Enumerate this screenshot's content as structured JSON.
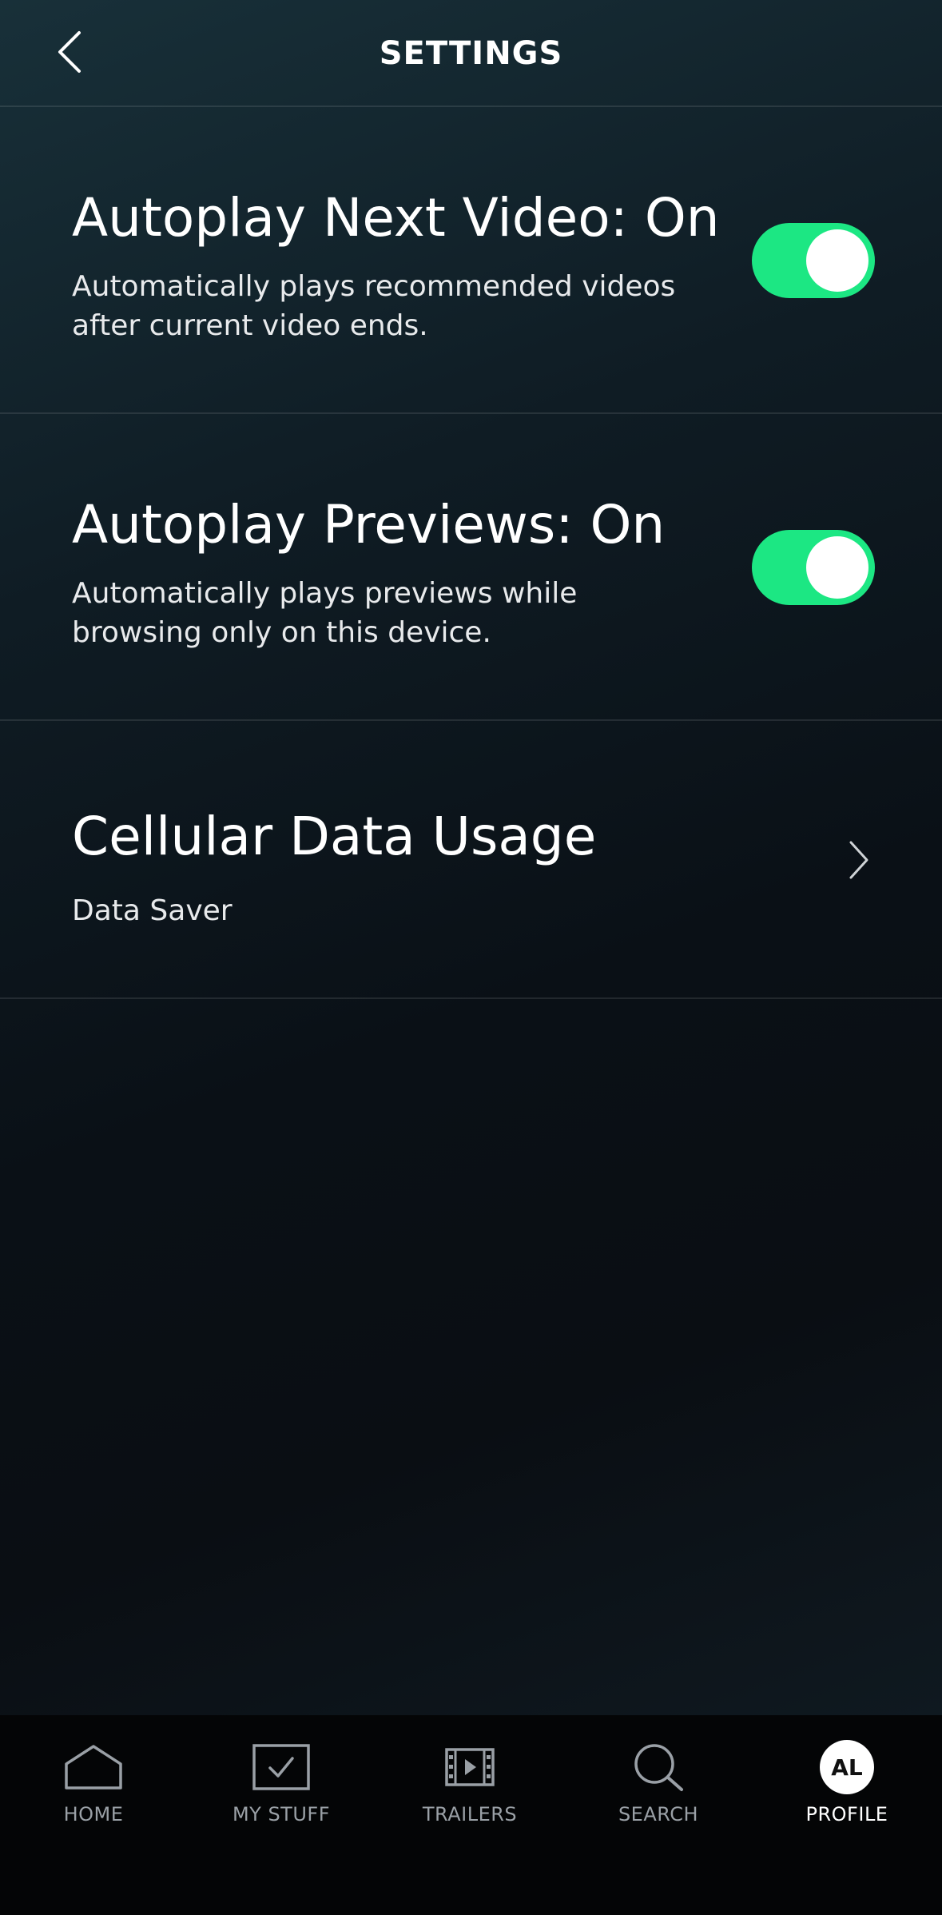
{
  "header": {
    "title": "SETTINGS",
    "back_icon": "chevron-left-icon"
  },
  "settings": [
    {
      "title": "Autoplay Next Video: On",
      "description": "Automatically plays recommended videos after current video ends.",
      "control": "toggle",
      "enabled": true
    },
    {
      "title": "Autoplay Previews: On",
      "description": "Automatically plays previews while browsing only on this device.",
      "control": "toggle",
      "enabled": true
    },
    {
      "title": "Cellular Data Usage",
      "description": "Data Saver",
      "control": "chevron",
      "icon": "chevron-right-icon"
    }
  ],
  "tabbar": {
    "tabs": [
      {
        "label": "HOME",
        "icon": "home-icon"
      },
      {
        "label": "MY STUFF",
        "icon": "checkbox-icon"
      },
      {
        "label": "TRAILERS",
        "icon": "film-icon"
      },
      {
        "label": "SEARCH",
        "icon": "search-icon"
      },
      {
        "label": "PROFILE",
        "icon": "avatar",
        "initials": "AL",
        "active": true
      }
    ]
  },
  "colors": {
    "accent": "#1ce783",
    "background_top": "#183039",
    "background_bottom": "#0a0e13",
    "tabbar": "#040506",
    "inactive_label": "#9aa0a6"
  }
}
